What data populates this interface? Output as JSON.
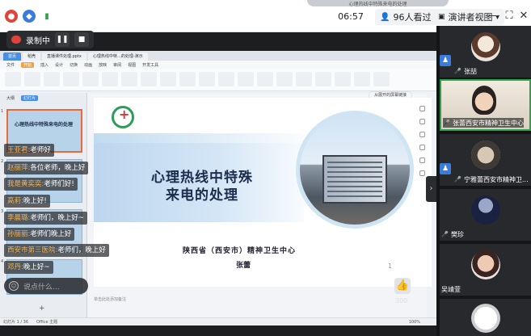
{
  "topbar": {
    "banner_text": "心理热线中特殊来电的处理",
    "timer": "06:57",
    "viewers_label": "96人看过",
    "view_mode_label": "演讲者视图"
  },
  "record": {
    "status_label": "录制中"
  },
  "ppt": {
    "tabs": [
      "首页",
      "稻壳",
      "直播课件处理.pptx",
      "心理热线中特…的处理-演示"
    ],
    "menu": [
      "文件",
      "开始",
      "插入",
      "设计",
      "切换",
      "动画",
      "放映",
      "审阅",
      "视图",
      "开发工具"
    ],
    "active_menu": "开始",
    "thumb_tabs": [
      "大纲",
      "幻灯片"
    ],
    "thumb_title": "心理热线中特殊来电的处理",
    "slide": {
      "title_line1": "心理热线中特殊",
      "title_line2": "来电的处理",
      "org": "陕西省（西安市）精神卫生中心",
      "author": "张蕾",
      "page": "1",
      "smart_button": "从展开的屏幕链接"
    },
    "notes_placeholder": "单击此处添加备注",
    "status": {
      "slide_count": "幻灯片 1 / 36",
      "theme": "Office 主题",
      "zoom": "100%"
    }
  },
  "chat": {
    "messages": [
      {
        "name": "王亚君:",
        "text": "老师好"
      },
      {
        "name": "赵丽萍:",
        "text": "各位老师，晚上好"
      },
      {
        "name": "我是黄奕奕:",
        "text": "老师们好!"
      },
      {
        "name": "高莉:",
        "text": "晚上好!"
      },
      {
        "name": "李晨璐:",
        "text": "老师们，晚上好~"
      },
      {
        "name": "孙丽丽:",
        "text": "老师们晚上好"
      },
      {
        "name": "西安市第三医院:",
        "text": "老师们，晚上好"
      },
      {
        "name": "邓丹:",
        "text": "晚上好~"
      }
    ],
    "input_placeholder": "说点什么..."
  },
  "like_count": "300",
  "participants": [
    {
      "name": "张喆"
    },
    {
      "name": "张蕾西安市精神卫生中心"
    },
    {
      "name": "宁雅蕾西安市精神卫..."
    },
    {
      "name": "樊珍"
    },
    {
      "name": "吴靖萱"
    }
  ]
}
